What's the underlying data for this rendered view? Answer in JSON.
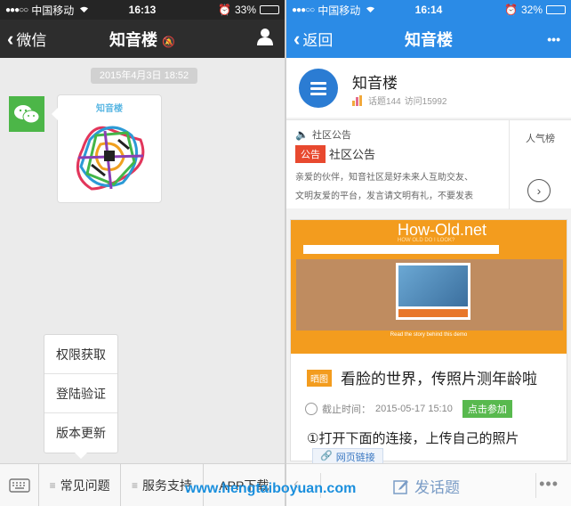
{
  "left": {
    "status": {
      "carrier": "中国移动",
      "time": "16:13",
      "battery": "33%",
      "battery_level": 0.33
    },
    "nav": {
      "back_label": "微信",
      "title": "知音楼"
    },
    "chat": {
      "timestamp": "2015年4月3日 18:52",
      "qr_card_title": "知音楼"
    },
    "popup_menu": [
      "权限获取",
      "登陆验证",
      "版本更新"
    ],
    "bottom_menu": [
      "常见问题",
      "服务支持",
      "APP下载"
    ]
  },
  "right": {
    "status": {
      "carrier": "中国移动",
      "time": "16:14",
      "battery": "32%",
      "battery_level": 0.32
    },
    "nav": {
      "back_label": "返回",
      "title": "知音楼",
      "more": "•••"
    },
    "forum": {
      "name": "知音楼",
      "topics": "话题144",
      "visits": "访问15992"
    },
    "notice": {
      "header": "社区公告",
      "badge": "公告",
      "title": "社区公告",
      "desc_line1": "亲爱的伙伴，知音社区是好未来人互助交友、",
      "desc_line2": "文明友爱的平台，发言请文明有礼，不要发表",
      "rank_label": "人气榜"
    },
    "post": {
      "banner_title": "How-Old.net",
      "banner_sub": "HOW OLD DO I LOOK?",
      "banner_foot": "Read the story behind this demo",
      "tag": "晒图",
      "title": "看脸的世界，传照片测年龄啦",
      "deadline_label": "截止时间：",
      "deadline": "2015-05-17 15:10",
      "join": "点击参加",
      "body": "①打开下面的连接，上传自己的照片",
      "link": "网页链接"
    },
    "bottom": {
      "post_topic": "发话题"
    }
  },
  "watermark": "www.hengtaiboyuan.com"
}
